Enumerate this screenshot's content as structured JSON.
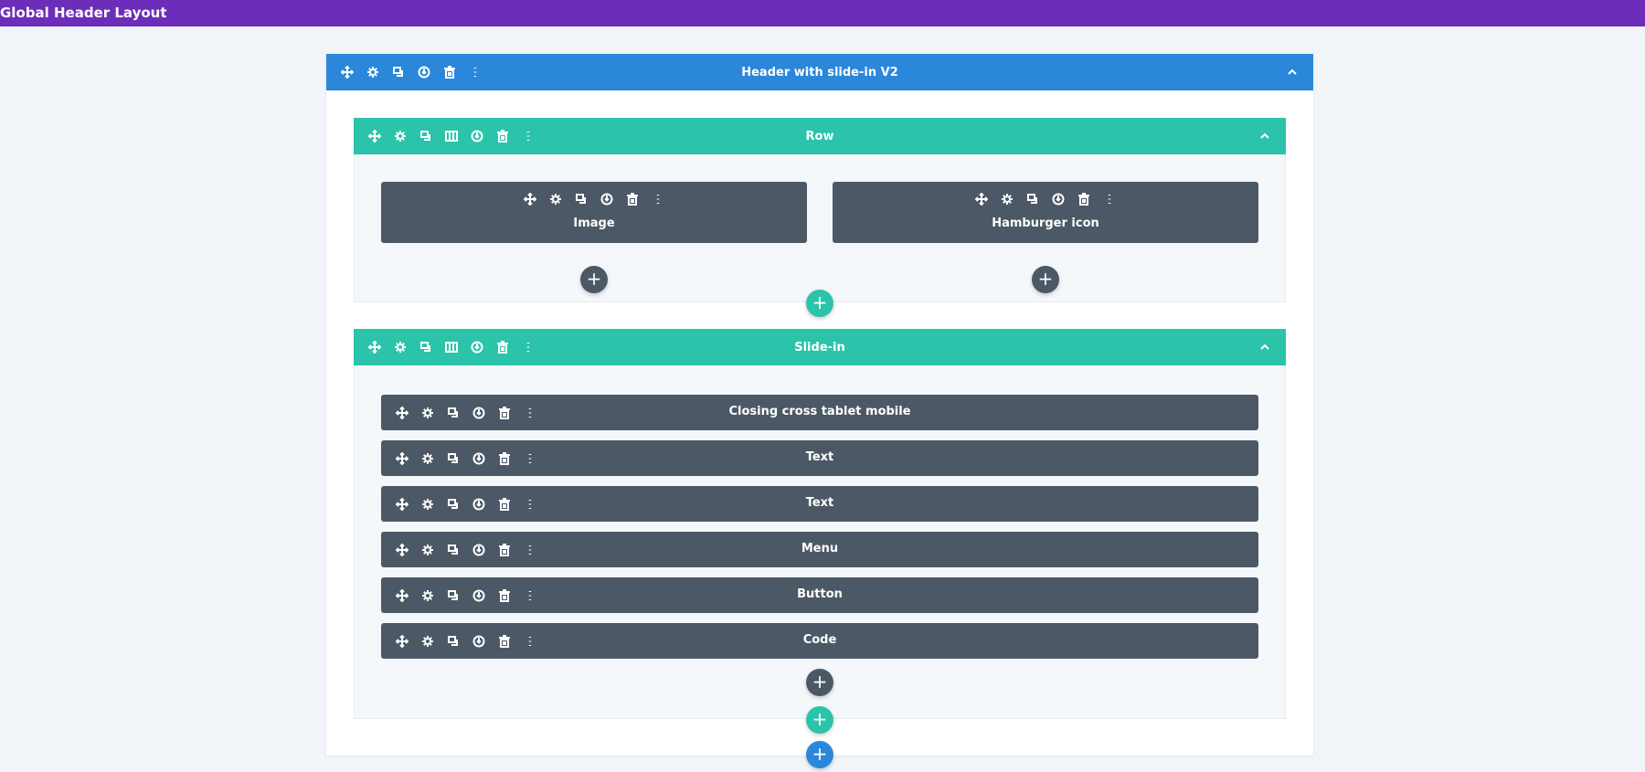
{
  "app": {
    "title": "Global Header Layout"
  },
  "section": {
    "title": "Header with slide-in V2",
    "color": "#2b87da"
  },
  "rows": [
    {
      "title": "Row",
      "modules": [
        "Image",
        "Hamburger icon"
      ]
    },
    {
      "title": "Slide-in",
      "modules": [
        "Closing cross tablet mobile",
        "Text",
        "Text",
        "Menu",
        "Button",
        "Code"
      ]
    }
  ],
  "plus_label": "+"
}
